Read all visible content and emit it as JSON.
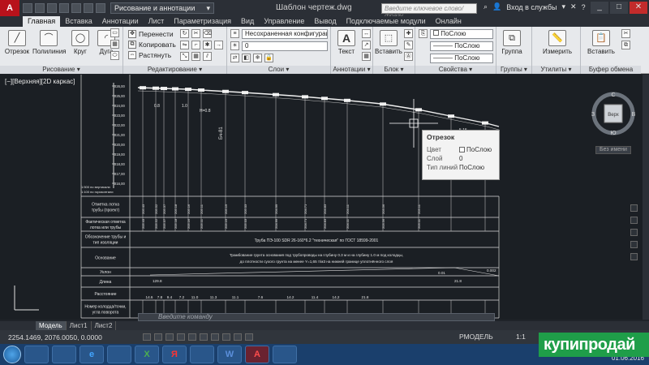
{
  "app": {
    "logo_letter": "A",
    "workspace": "Рисование и аннотации",
    "doc_title": "Шаблон чертеж.dwg",
    "search_placeholder": "Введите ключевое слово/фразу",
    "signin": "Вход в службы",
    "window_controls": [
      "_",
      "□",
      "✕"
    ]
  },
  "tabs": [
    "Главная",
    "Вставка",
    "Аннотации",
    "Лист",
    "Параметризация",
    "Вид",
    "Управление",
    "Вывод",
    "Подключаемые модули",
    "Онлайн"
  ],
  "ribbon": {
    "draw": {
      "title": "Рисование",
      "buttons": [
        "Отрезок",
        "Полилиния",
        "Круг",
        "Дуга"
      ]
    },
    "modify": {
      "title": "Редактирование",
      "buttons": [
        "Перенести",
        "Копировать",
        "Растянуть"
      ]
    },
    "layers": {
      "title": "Слои",
      "layer_state": "Несохраненная конфигурация сло",
      "layer_number": "0"
    },
    "annotation": {
      "title": "Аннотации",
      "buttons": [
        "Текст"
      ]
    },
    "block": {
      "title": "Блок",
      "buttons": [
        "Вставить"
      ]
    },
    "properties": {
      "title": "Свойства",
      "color": "ПоСлою",
      "linetype": "ПоСлою",
      "lineweight": "ПоСлою"
    },
    "groups": {
      "title": "Группы",
      "buttons": [
        "Группа"
      ]
    },
    "utilities": {
      "title": "Утилиты",
      "buttons": [
        "Измерить"
      ]
    },
    "clipboard": {
      "title": "Буфер обмена",
      "buttons": [
        "Вставить"
      ]
    }
  },
  "drawing": {
    "viewport_label": "[−][Верхняя][2D каркас]",
    "elev_ticks": [
      "226,00",
      "225,00",
      "224,00",
      "223,00",
      "222,00",
      "221,00",
      "220,00",
      "219,00",
      "218,00",
      "217,00",
      "216,00"
    ],
    "scale_note": [
      "1:500 по вертикали",
      "1:100 по горизонтали"
    ],
    "row_labels": [
      [
        "Отметка лотка",
        "трубы (проект)"
      ],
      [
        "Фактическая отметка",
        "лотка или трубы"
      ],
      [
        "Обозначение трубы и",
        "тип изоляции"
      ],
      [
        "Основание"
      ],
      [
        "Уклон"
      ],
      [
        "Длина"
      ],
      [
        "Расстояние"
      ],
      [
        "Номер колодца/точки,",
        "угла поворота"
      ]
    ],
    "pipe_note": "Труба ПЭ-100 SDR 26-160*6.2 \"техническая\" по ГОСТ 18599-2001",
    "base_note": [
      "Трамбование грунта основания под трубопроводы на глубину 0.3 м и на глубину 1.0 м под колодцы,",
      "до плотности сухого грунта на менее Y=1,65 т/м3 на нижней границе уплотнённого слоя"
    ],
    "slope_values": [
      "0.01",
      "0.002"
    ],
    "length_values": [
      "129.8",
      "21.8"
    ],
    "distance_values": [
      "14.6",
      "7.8",
      "9.4",
      "7.2",
      "11.0",
      "11.3",
      "11.1",
      "7.6",
      "14.2",
      "11.4",
      "14.2",
      "21.8"
    ],
    "profile_labels": [
      "0.8",
      "1.0",
      "H=0.8",
      "Бч-81",
      "5.15"
    ],
    "design_elevs": [
      "205.43",
      "205.52",
      "205.37",
      "205.18",
      "205.16",
      "205.11",
      "205.19",
      "205.03",
      "204.99",
      "204.71",
      "204.83",
      "204.11",
      "203.56",
      "203.11"
    ],
    "actual_elevs": [
      "205.43",
      "205.52",
      "205.37",
      "205.18",
      "205.16",
      "205.11",
      "205.19",
      "205.03",
      "204.99",
      "204.71",
      "204.83",
      "204.11",
      "203.56",
      "203.11"
    ],
    "command_placeholder": "Введите команду",
    "viewcube": {
      "face": "Верх",
      "n": "С",
      "s": "Ю",
      "w": "З",
      "e": "В"
    },
    "wcs": "Без имени"
  },
  "tooltip": {
    "title": "Отрезок",
    "rows": [
      {
        "key": "Цвет",
        "value": "ПоСлою"
      },
      {
        "key": "Слой",
        "value": "0"
      },
      {
        "key": "Тип линий",
        "value": "ПоСлою"
      }
    ]
  },
  "layout_tabs": [
    "Модель",
    "Лист1",
    "Лист2"
  ],
  "status": {
    "coords": "2254.1469, 2076.0050, 0.0000",
    "mode": "РМОДЕЛЬ",
    "scale": "1:1"
  },
  "taskbar": {
    "date": "01.06.2016",
    "apps": [
      "",
      "",
      "e",
      "",
      "X",
      "Я",
      "",
      "W",
      "A",
      ""
    ]
  },
  "watermark": "купипродай"
}
